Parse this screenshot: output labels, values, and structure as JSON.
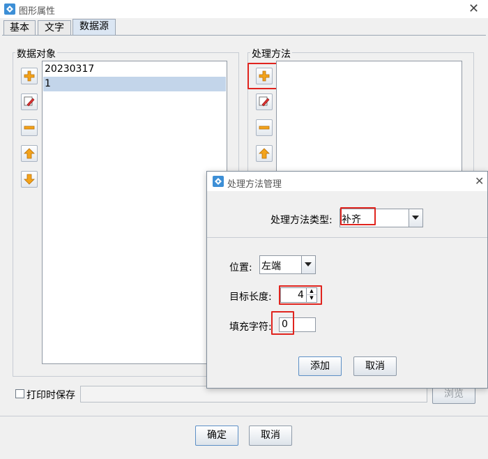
{
  "window": {
    "title": "图形属性"
  },
  "tabs": [
    {
      "label": "基本",
      "active": false
    },
    {
      "label": "文字",
      "active": false
    },
    {
      "label": "数据源",
      "active": true
    }
  ],
  "data_objects": {
    "label": "数据对象",
    "items": [
      "20230317",
      "1"
    ],
    "selected_index": 1
  },
  "process_methods": {
    "label": "处理方法",
    "items": []
  },
  "footer": {
    "print_save_label": "打印时保存",
    "print_save_checked": false,
    "path_value": "",
    "browse_label": "浏览",
    "ok_label": "确定",
    "cancel_label": "取消"
  },
  "dialog": {
    "title": "处理方法管理",
    "type_label": "处理方法类型:",
    "type_value": "补齐",
    "position_label": "位置:",
    "position_value": "左端",
    "target_length_label": "目标长度:",
    "target_length_value": "4",
    "fill_char_label": "填充字符:",
    "fill_char_value": "0",
    "add_label": "添加",
    "cancel_label": "取消"
  },
  "colors": {
    "highlight_red": "#e0241e",
    "selection_blue": "#c3d5ea",
    "icon_orange": "#f3a31b",
    "icon_blue": "#4a90d9"
  }
}
